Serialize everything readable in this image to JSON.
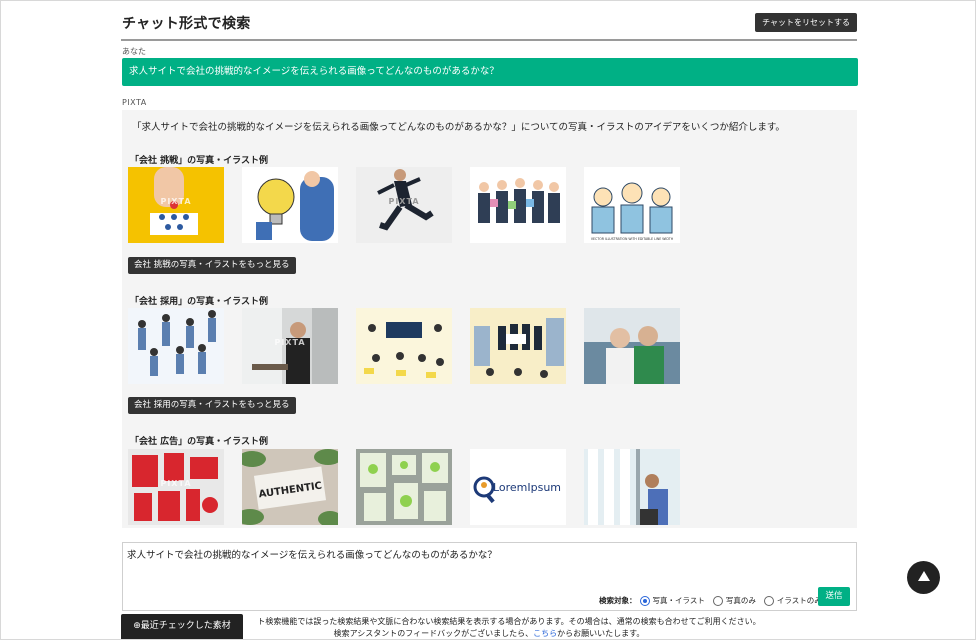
{
  "header": {
    "title": "チャット形式で検索",
    "reset_label": "チャットをリセットする"
  },
  "conversation": {
    "user_label": "あなた",
    "user_message": "求人サイトで会社の挑戦的なイメージを伝えられる画像ってどんなのものがあるかな？",
    "assistant_label": "PIXTA",
    "intro": "「求人サイトで会社の挑戦的なイメージを伝えられる画像ってどんなのものがあるかな？」についての写真・イラストのアイデアをいくつか紹介します。",
    "sections": [
      {
        "title": "「会社 挑戦」の写真・イラスト例",
        "more_label": "会社 挑戦の写真・イラストをもっと見る",
        "thumbs": [
          {
            "icon": "hand-holding-pieces-photo",
            "bg": "#f5c200",
            "wm": "PIXTA"
          },
          {
            "icon": "lightbulb-businessman-illustration",
            "bg": "#ffffff",
            "wm": ""
          },
          {
            "icon": "jumping-businessman-photo",
            "bg": "#eeeeee",
            "wm": "PIXTA"
          },
          {
            "icon": "business-team-puzzle-illustration",
            "bg": "#ffffff",
            "wm": ""
          },
          {
            "icon": "cheering-office-workers-illustration",
            "bg": "#ffffff",
            "wm": "VECTOR ILLUSTRATION WITH EDITABLE LINE WIDTH"
          }
        ]
      },
      {
        "title": "「会社 採用」の写真・イラスト例",
        "more_label": "会社 採用の写真・イラストをもっと見る",
        "thumbs": [
          {
            "icon": "running-business-people-illustration",
            "bg": "#f2f6fb",
            "wm": ""
          },
          {
            "icon": "businessman-office-window-photo",
            "bg": "#d6d8d8",
            "wm": "PIXTA"
          },
          {
            "icon": "recruitment-doodle-illustration",
            "bg": "#fbf6dc",
            "wm": ""
          },
          {
            "icon": "new-employees-city-illustration",
            "bg": "#f8eec8",
            "wm": ""
          },
          {
            "icon": "senior-couple-photo",
            "bg": "#6b8aa0",
            "wm": ""
          }
        ]
      },
      {
        "title": "「会社 広告」の写真・イラスト例",
        "more_label": "",
        "thumbs": [
          {
            "icon": "red-branding-mockup-photo",
            "bg": "#e8e8e8",
            "wm": "PIXTA"
          },
          {
            "icon": "authentic-sign-plants-photo",
            "bg": "#cfc6ba",
            "wm": "AUTHENTIC"
          },
          {
            "icon": "green-stationery-mockup-photo",
            "bg": "#9aa29a",
            "wm": ""
          },
          {
            "icon": "lorem-ipsum-logo",
            "bg": "#ffffff",
            "wm": "LoremIpsum"
          },
          {
            "icon": "man-looking-window-photo",
            "bg": "#e4eef2",
            "wm": ""
          }
        ]
      }
    ]
  },
  "input": {
    "value": "求人サイトで会社の挑戦的なイメージを伝えられる画像ってどんなのものがあるかな？",
    "search_target_label": "検索対象：",
    "options": [
      "写真・イラスト",
      "写真のみ",
      "イラストのみ"
    ],
    "selected": "写真・イラスト",
    "send_label": "送信"
  },
  "footer": {
    "line1": "ト検索機能では誤った検索結果や文脈に合わない検索結果を表示する場合があります。その場合は、通常の検索も合わせてご利用ください。",
    "line2_prefix": "検索アシスタントのフィードバックがございましたら、",
    "line2_link": "こちら",
    "line2_suffix": "からお願いいたします。"
  },
  "recent": {
    "label": "最近チェックした素材"
  },
  "colors": {
    "accent": "#00b085",
    "dark": "#333333"
  }
}
